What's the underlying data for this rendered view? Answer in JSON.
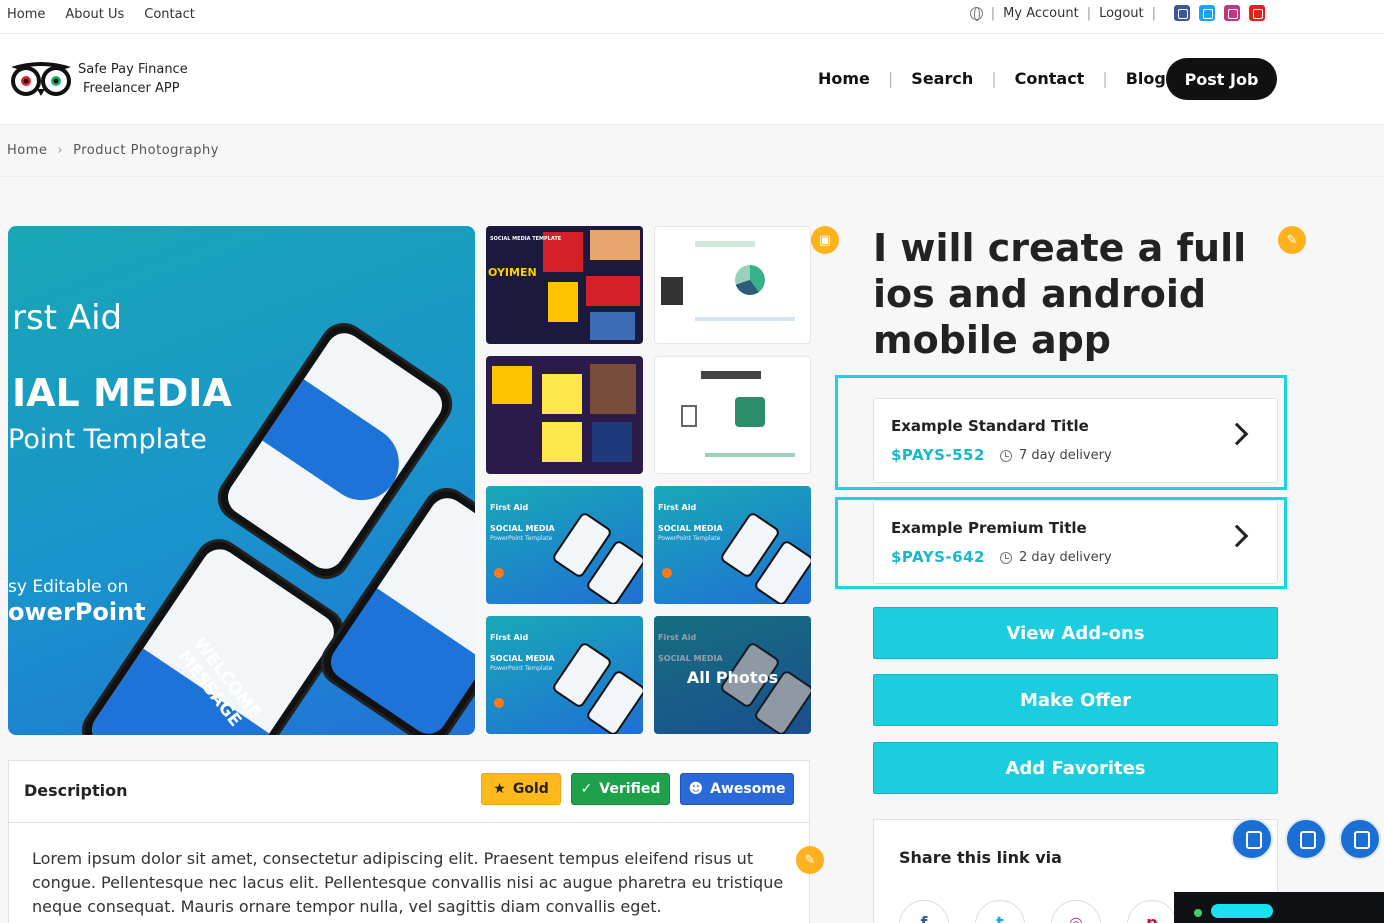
{
  "topbar": {
    "links": [
      "Home",
      "About Us",
      "Contact"
    ],
    "my_account": "My Account",
    "logout": "Logout",
    "social_icons": [
      {
        "name": "facebook-icon",
        "color": "#3b5998"
      },
      {
        "name": "twitter-icon",
        "color": "#1da1f2"
      },
      {
        "name": "instagram-icon",
        "color": "#c13584"
      },
      {
        "name": "youtube-icon",
        "color": "#e62117"
      }
    ]
  },
  "header": {
    "logo_line1": "Safe Pay Finance",
    "logo_line2": "Freelancer APP",
    "nav": [
      "Home",
      "Search",
      "Contact",
      "Blog"
    ],
    "post_job": "Post Job"
  },
  "breadcrumb": {
    "home": "Home",
    "separator": "›",
    "current": "Product Photography"
  },
  "gallery": {
    "hero": {
      "line1": "rst Aid",
      "line2": "IAL MEDIA",
      "line3": "Point Template",
      "line4": "sy Editable on",
      "line5": "owerPoint",
      "welcome": "WELCOME MESSAGE"
    },
    "thumb_dark_label": "SOCIAL MEDIA TEMPLATE",
    "thumb_dark_big": "OYIMEN",
    "thumb_first_aid": "First Aid",
    "thumb_social_media": "SOCIAL MEDIA",
    "thumb_template": "PowerPoint Template",
    "all_photos": "All Photos"
  },
  "gig": {
    "title": "I will create a full ios and android mobile app",
    "packages": [
      {
        "name": "Example Standard Title",
        "price": "$PAYS-552",
        "delivery": "7 day delivery"
      },
      {
        "name": "Example Premium Title",
        "price": "$PAYS-642",
        "delivery": "2 day delivery"
      }
    ],
    "buttons": {
      "addons": "View Add-ons",
      "offer": "Make Offer",
      "favorites": "Add Favorites"
    }
  },
  "share": {
    "title": "Share this link via",
    "icons": [
      "f",
      "t",
      "◎",
      "p"
    ]
  },
  "description": {
    "title": "Description",
    "tags": {
      "gold": "Gold",
      "verified": "Verified",
      "awesome": "Awesome"
    },
    "text": "Lorem ipsum dolor sit amet, consectetur adipiscing elit. Praesent tempus eleifend risus ut congue. Pellentesque nec lacus elit. Pellentesque convallis nisi ac augue pharetra eu tristique neque consequat. Mauris ornare tempor nulla, vel sagittis diam convallis eget."
  },
  "colors": {
    "accent": "#1ccde0",
    "price": "#17b8c9",
    "edit_badge": "#ffb21e",
    "highlight": "#18d6e0"
  }
}
